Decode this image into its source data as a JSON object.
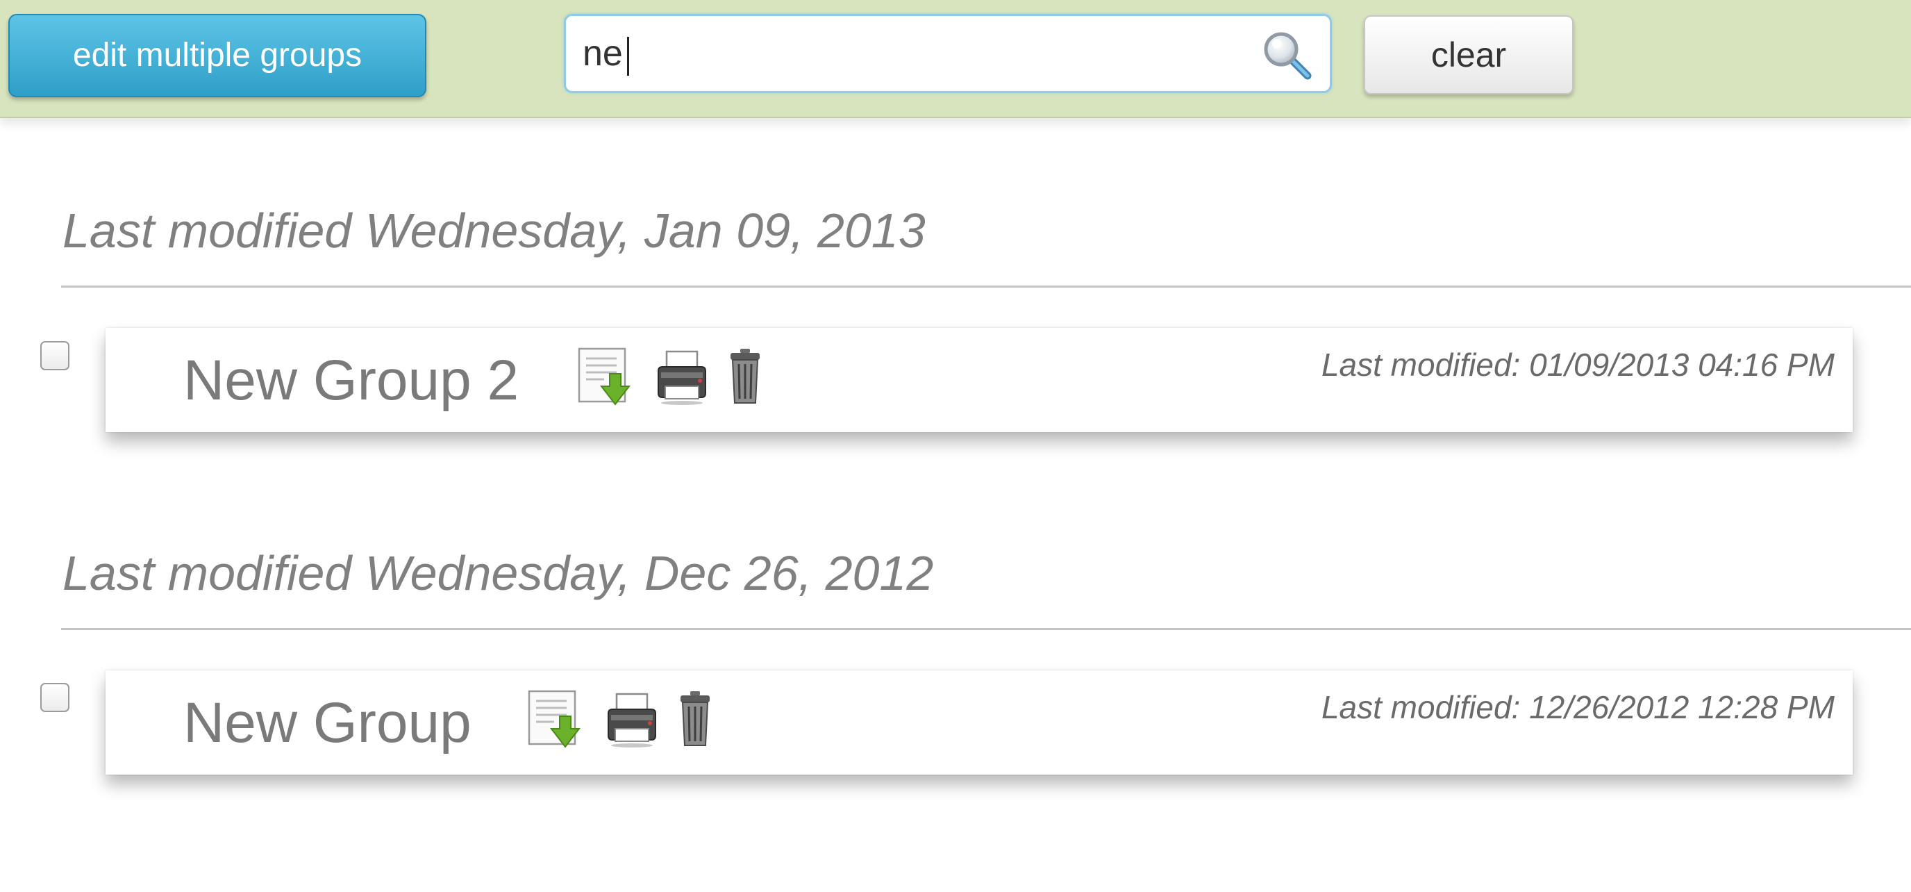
{
  "toolbar": {
    "edit_button_label": "edit multiple groups",
    "search_value": "ne",
    "clear_button_label": "clear"
  },
  "sections": [
    {
      "heading": "Last modified Wednesday, Jan 09, 2013",
      "group": {
        "name": "New Group 2",
        "modified": "Last modified: 01/09/2013 04:16 PM"
      }
    },
    {
      "heading": "Last modified Wednesday, Dec 26, 2012",
      "group": {
        "name": "New Group",
        "modified": "Last modified: 12/26/2012 12:28 PM"
      }
    }
  ],
  "icons": {
    "download": "download-icon",
    "print": "printer-icon",
    "delete": "trash-icon",
    "search": "search-icon"
  },
  "colors": {
    "toolbar_bg": "#d7e4bd",
    "edit_button": "#3aaed8",
    "heading_text": "#808080"
  }
}
